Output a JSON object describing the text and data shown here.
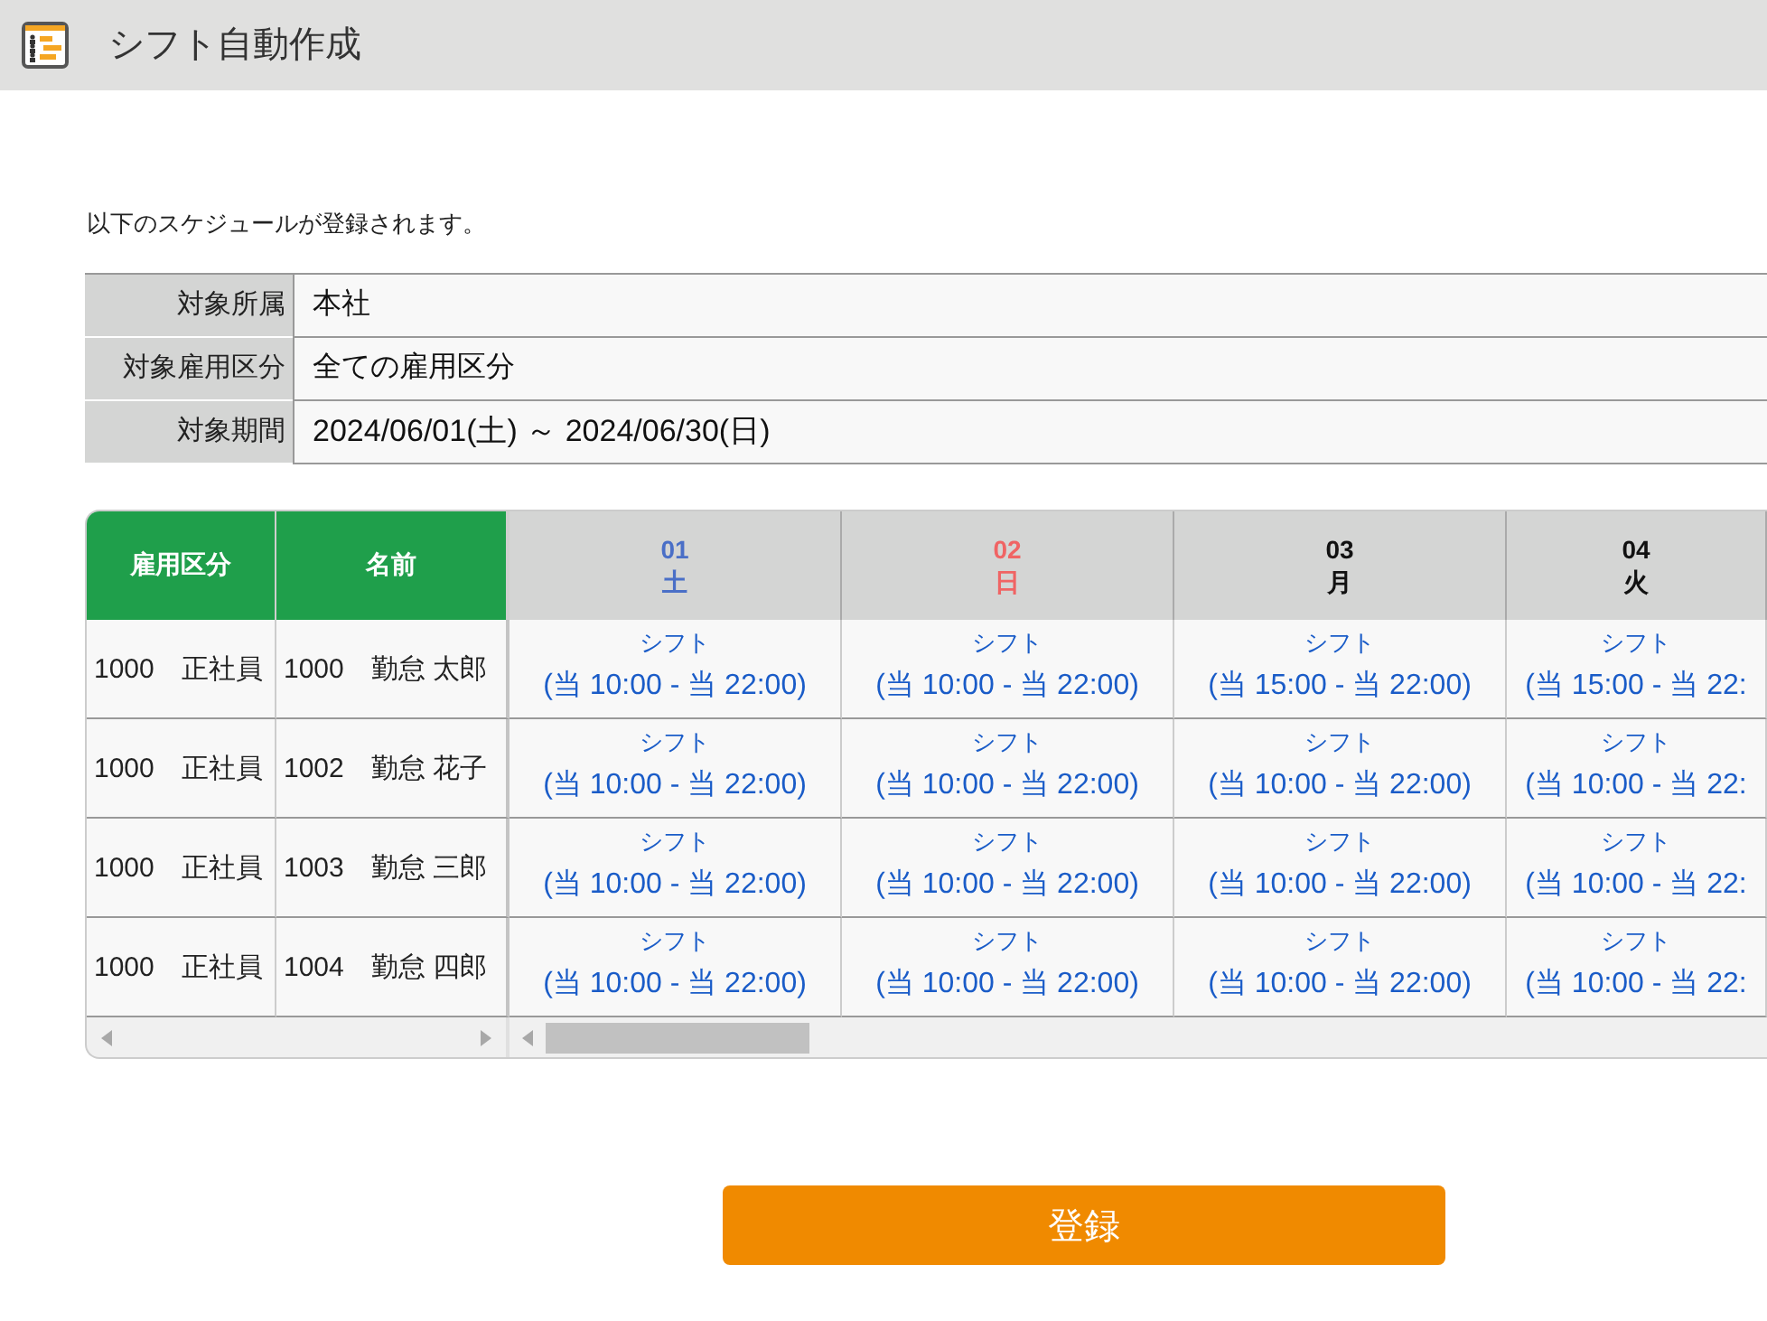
{
  "header": {
    "title": "シフト自動作成"
  },
  "message": "以下のスケジュールが登録されます。",
  "summary": [
    {
      "label": "対象所属",
      "value": "本社"
    },
    {
      "label": "対象雇用区分",
      "value": "全ての雇用区分"
    },
    {
      "label": "対象期間",
      "value": "2024/06/01(土) ～ 2024/06/30(日)"
    }
  ],
  "schedule": {
    "columns": [
      "雇用区分",
      "名前"
    ],
    "days": [
      {
        "date": "01",
        "weekday": "土",
        "kind": "saturday"
      },
      {
        "date": "02",
        "weekday": "日",
        "kind": "sunday"
      },
      {
        "date": "03",
        "weekday": "月",
        "kind": "weekday"
      },
      {
        "date": "04",
        "weekday": "火",
        "kind": "weekday"
      }
    ],
    "rows": [
      {
        "employment_type": "1000　正社員",
        "name": "1000　勤怠 太郎",
        "shifts": [
          {
            "label": "シフト",
            "time": "(当 10:00 - 当 22:00)"
          },
          {
            "label": "シフト",
            "time": "(当 10:00 - 当 22:00)"
          },
          {
            "label": "シフト",
            "time": "(当 15:00 - 当 22:00)"
          },
          {
            "label": "シフト",
            "time": "(当 15:00 - 当 22:"
          }
        ]
      },
      {
        "employment_type": "1000　正社員",
        "name": "1002　勤怠 花子",
        "shifts": [
          {
            "label": "シフト",
            "time": "(当 10:00 - 当 22:00)"
          },
          {
            "label": "シフト",
            "time": "(当 10:00 - 当 22:00)"
          },
          {
            "label": "シフト",
            "time": "(当 10:00 - 当 22:00)"
          },
          {
            "label": "シフト",
            "time": "(当 10:00 - 当 22:"
          }
        ]
      },
      {
        "employment_type": "1000　正社員",
        "name": "1003　勤怠 三郎",
        "shifts": [
          {
            "label": "シフト",
            "time": "(当 10:00 - 当 22:00)"
          },
          {
            "label": "シフト",
            "time": "(当 10:00 - 当 22:00)"
          },
          {
            "label": "シフト",
            "time": "(当 10:00 - 当 22:00)"
          },
          {
            "label": "シフト",
            "time": "(当 10:00 - 当 22:"
          }
        ]
      },
      {
        "employment_type": "1000　正社員",
        "name": "1004　勤怠 四郎",
        "shifts": [
          {
            "label": "シフト",
            "time": "(当 10:00 - 当 22:00)"
          },
          {
            "label": "シフト",
            "time": "(当 10:00 - 当 22:00)"
          },
          {
            "label": "シフト",
            "time": "(当 10:00 - 当 22:00)"
          },
          {
            "label": "シフト",
            "time": "(当 10:00 - 当 22:"
          }
        ]
      }
    ]
  },
  "buttons": [
    "登録"
  ]
}
